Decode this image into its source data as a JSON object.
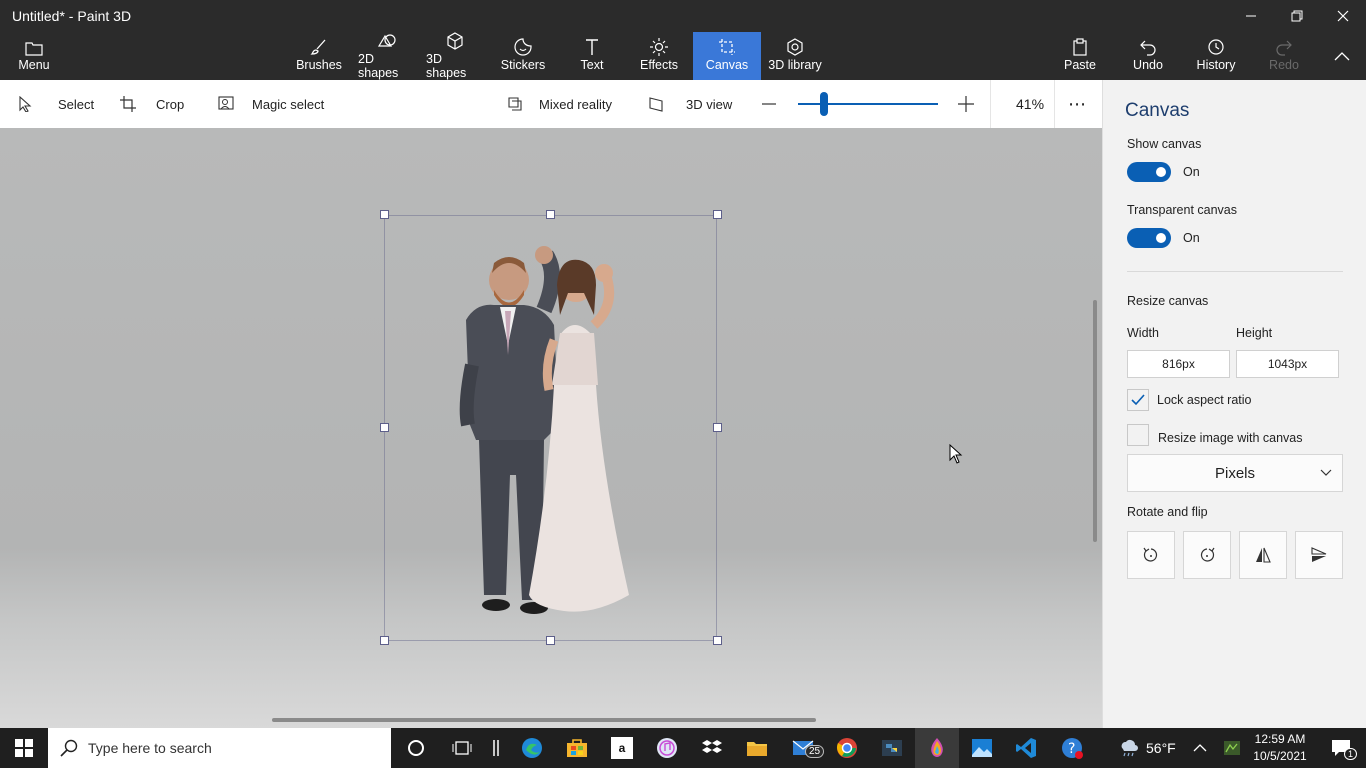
{
  "window": {
    "title": "Untitled* - Paint 3D"
  },
  "ribbon": {
    "menu_label": "Menu",
    "tools": [
      {
        "label": "Brushes",
        "icon": "brush-icon"
      },
      {
        "label": "2D shapes",
        "icon": "2d-shapes-icon"
      },
      {
        "label": "3D shapes",
        "icon": "3d-shapes-icon"
      },
      {
        "label": "Stickers",
        "icon": "stickers-icon"
      },
      {
        "label": "Text",
        "icon": "text-icon"
      },
      {
        "label": "Effects",
        "icon": "effects-icon"
      },
      {
        "label": "Canvas",
        "icon": "canvas-icon",
        "active": true
      },
      {
        "label": "3D library",
        "icon": "3d-library-icon"
      }
    ],
    "paste_label": "Paste",
    "undo_label": "Undo",
    "history_label": "History",
    "redo_label": "Redo",
    "accent_color": "#3a78d8"
  },
  "toolbar": {
    "select_label": "Select",
    "crop_label": "Crop",
    "magic_select_label": "Magic select",
    "mixed_reality_label": "Mixed reality",
    "view3d_label": "3D view",
    "zoom_value": "41%",
    "more_label": "⋯"
  },
  "panel": {
    "title": "Canvas",
    "show_canvas_label": "Show canvas",
    "show_canvas_state": "On",
    "transparent_canvas_label": "Transparent canvas",
    "transparent_canvas_state": "On",
    "resize_canvas_label": "Resize canvas",
    "width_label": "Width",
    "height_label": "Height",
    "width_value": "816px",
    "height_value": "1043px",
    "lock_aspect_label": "Lock aspect ratio",
    "lock_aspect_checked": true,
    "resize_image_label": "Resize image with canvas",
    "resize_image_checked": false,
    "units_value": "Pixels",
    "rotate_flip_label": "Rotate and flip"
  },
  "taskbar": {
    "search_placeholder": "Type here to search",
    "mail_badge": "25",
    "weather": "56°F",
    "time": "12:59 AM",
    "date": "10/5/2021",
    "notification_count": "1"
  }
}
